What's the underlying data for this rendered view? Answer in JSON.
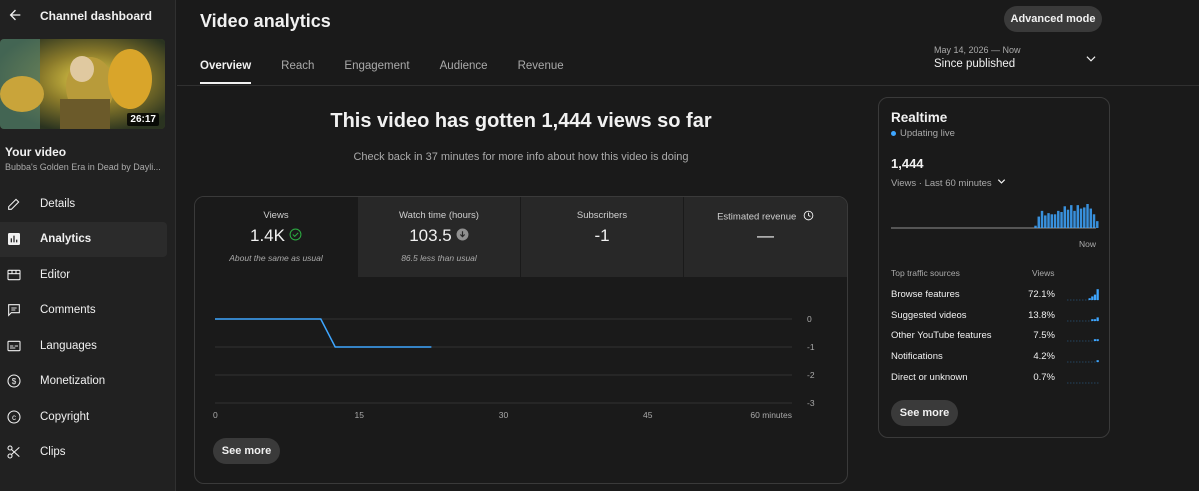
{
  "sidebar": {
    "title": "Channel dashboard",
    "thumbnail_duration": "26:17",
    "your_video_label": "Your video",
    "video_title": "Bubba's Golden Era in Dead by Dayli...",
    "items": [
      {
        "label": "Details",
        "icon": "pencil-icon"
      },
      {
        "label": "Analytics",
        "icon": "analytics-icon",
        "active": true
      },
      {
        "label": "Editor",
        "icon": "editor-icon"
      },
      {
        "label": "Comments",
        "icon": "comments-icon"
      },
      {
        "label": "Languages",
        "icon": "subtitles-icon"
      },
      {
        "label": "Monetization",
        "icon": "dollar-icon"
      },
      {
        "label": "Copyright",
        "icon": "copyright-icon"
      },
      {
        "label": "Clips",
        "icon": "scissors-icon"
      }
    ]
  },
  "header": {
    "title": "Video analytics",
    "advanced_mode_label": "Advanced mode",
    "tabs": [
      {
        "label": "Overview",
        "active": true
      },
      {
        "label": "Reach"
      },
      {
        "label": "Engagement"
      },
      {
        "label": "Audience"
      },
      {
        "label": "Revenue"
      }
    ],
    "date_range": "May 14, 2026 — Now",
    "date_label": "Since published"
  },
  "main": {
    "headline": "This video has gotten 1,444 views so far",
    "subline": "Check back in 37 minutes for more info about how this video is doing",
    "metrics": [
      {
        "title": "Views",
        "value": "1.4K",
        "note": "About the same as usual",
        "status": "check-icon"
      },
      {
        "title": "Watch time (hours)",
        "value": "103.5",
        "note": "86.5 less than usual",
        "status": "arrow-down-icon"
      },
      {
        "title": "Subscribers",
        "value": "-1",
        "note": ""
      },
      {
        "title": "Estimated revenue",
        "value": "—",
        "note": "",
        "status": "clock-icon"
      }
    ],
    "see_more_label": "See more"
  },
  "chart_data": {
    "type": "line",
    "x": [
      0,
      11,
      12.5,
      22.5
    ],
    "values": [
      0,
      0,
      -1,
      -1
    ],
    "x_ticks": [
      "0",
      "15",
      "30",
      "45",
      "60 minutes"
    ],
    "y_ticks": [
      "0",
      "-1",
      "-2",
      "-3"
    ],
    "xlim": [
      0,
      60
    ],
    "ylim": [
      -3,
      0
    ],
    "grid": true,
    "color": "#3ea6ff"
  },
  "realtime": {
    "title": "Realtime",
    "status": "Updating live",
    "count": "1,444",
    "subtitle": "Views · Last 60 minutes",
    "now_label": "Now",
    "bars": [
      0,
      0,
      0,
      0,
      0,
      0,
      0,
      0,
      0,
      0,
      0,
      0,
      0,
      0,
      0,
      0,
      0,
      0,
      0,
      0,
      0,
      0,
      0,
      0,
      0,
      0,
      0,
      0,
      0,
      0,
      0,
      0,
      0,
      0,
      0,
      0,
      0,
      0,
      0,
      0,
      0,
      0,
      0,
      0,
      2,
      10,
      15,
      11,
      13,
      12,
      12,
      15,
      14,
      19,
      16,
      20,
      15,
      20,
      17,
      18,
      21,
      17,
      12,
      6
    ],
    "traffic_header_sources": "Top traffic sources",
    "traffic_header_views": "Views",
    "sources": [
      {
        "name": "Browse features",
        "pct": "72.1%",
        "spark": [
          0,
          0,
          0,
          0,
          0,
          0,
          0,
          0,
          1,
          2,
          3,
          6
        ]
      },
      {
        "name": "Suggested videos",
        "pct": "13.8%",
        "spark": [
          0,
          0,
          0,
          0,
          0,
          0,
          0,
          0,
          0,
          1,
          1,
          2
        ]
      },
      {
        "name": "Other YouTube features",
        "pct": "7.5%",
        "spark": [
          0,
          0,
          0,
          0,
          0,
          0,
          0,
          0,
          0,
          0,
          1,
          1
        ]
      },
      {
        "name": "Notifications",
        "pct": "4.2%",
        "spark": [
          0,
          0,
          0,
          0,
          0,
          0,
          0,
          0,
          0,
          0,
          0,
          1
        ]
      },
      {
        "name": "Direct or unknown",
        "pct": "0.7%",
        "spark": [
          0,
          0,
          0,
          0,
          0,
          0,
          0,
          0,
          0,
          0,
          0,
          0
        ]
      }
    ],
    "see_more_label": "See more"
  },
  "colors": {
    "accent": "#3ea6ff",
    "check": "#2ba640"
  }
}
